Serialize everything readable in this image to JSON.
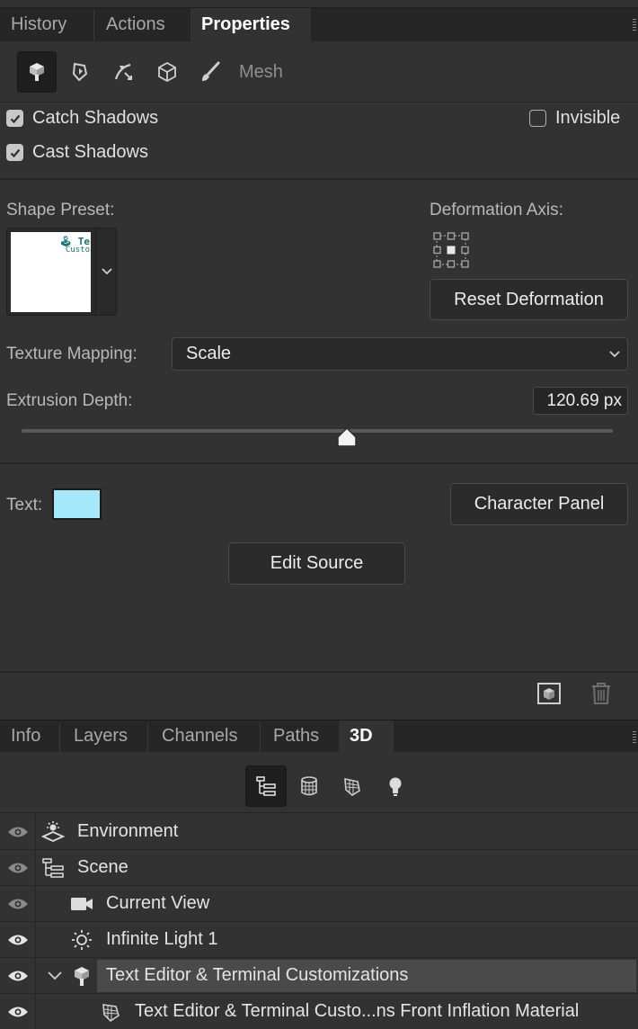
{
  "top_tabs": [
    "History",
    "Actions",
    "Properties"
  ],
  "mode_toolbar": {
    "icons": [
      "mesh-mode-icon",
      "deform-mode-icon",
      "cap-mode-icon",
      "coordinates-mode-icon",
      "brush-mode-icon"
    ],
    "label": "Mesh"
  },
  "shadows": {
    "catch_label": "Catch Shadows",
    "catch_checked": true,
    "cast_label": "Cast Shadows",
    "cast_checked": true,
    "invisible_label": "Invisible",
    "invisible_checked": false
  },
  "shape_preset": {
    "label": "Shape Preset:",
    "thumb_line1": "🕹 Te",
    "thumb_line2": "Custo"
  },
  "deformation": {
    "label": "Deformation Axis:",
    "reset_label": "Reset Deformation"
  },
  "texture_mapping": {
    "label": "Texture Mapping:",
    "value": "Scale"
  },
  "extrusion": {
    "label": "Extrusion Depth:",
    "value": "120.69 px",
    "slider_fraction": 0.55
  },
  "text": {
    "label": "Text:",
    "swatch_color": "#a6e8fb",
    "character_panel_label": "Character Panel",
    "edit_source_label": "Edit Source"
  },
  "bottom_tabs": [
    "Info",
    "Layers",
    "Channels",
    "Paths",
    "3D"
  ],
  "scene_tree": [
    {
      "label": "Environment",
      "icon": "environment-icon",
      "visible_strong": false
    },
    {
      "label": "Scene",
      "icon": "scene-icon",
      "visible_strong": false
    },
    {
      "label": "Current View",
      "icon": "camera-icon",
      "visible_strong": false
    },
    {
      "label": "Infinite Light 1",
      "icon": "light-icon",
      "visible_strong": true
    },
    {
      "label": "Text Editor & Terminal Customizations",
      "icon": "mesh-icon",
      "visible_strong": true,
      "selected": true
    },
    {
      "label": "Text Editor & Terminal Custo...ns Front Inflation Material",
      "icon": "material-icon",
      "visible_strong": true
    }
  ]
}
